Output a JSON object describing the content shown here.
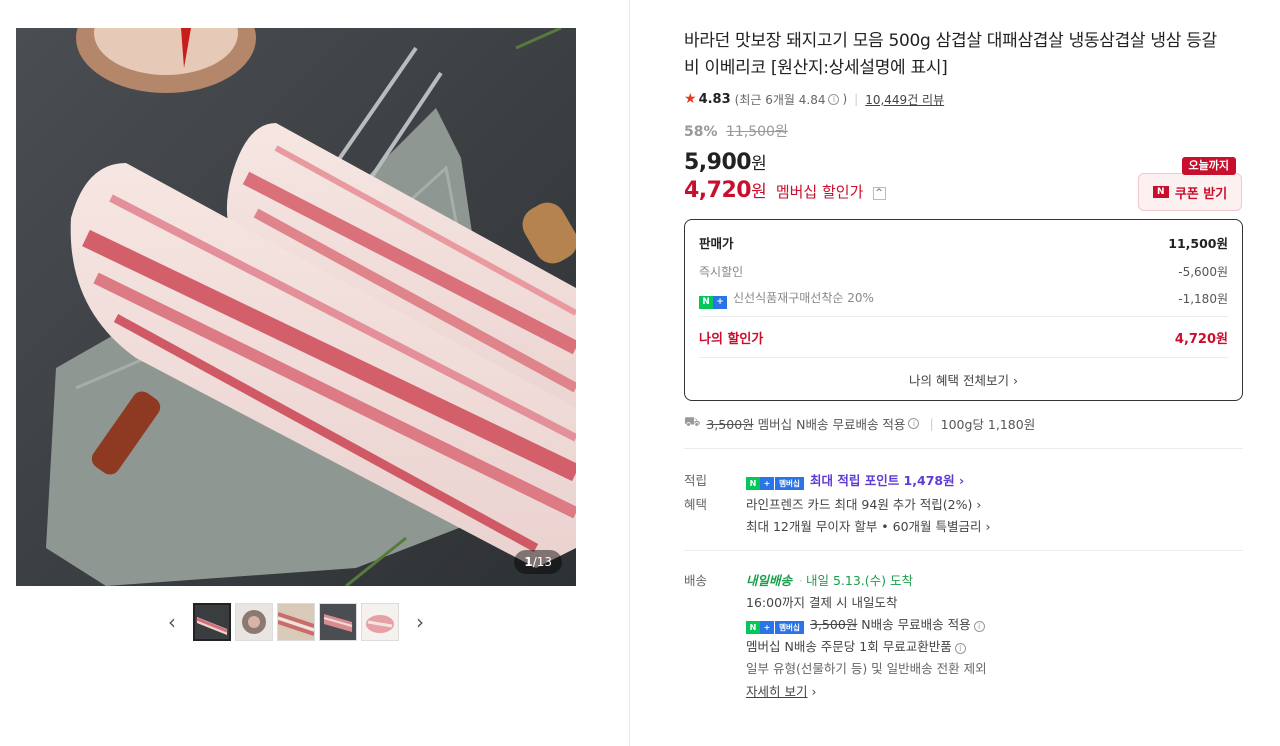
{
  "gallery": {
    "counter_current": "1",
    "counter_total": "/13",
    "prev_arrow": "‹",
    "next_arrow": "›",
    "thumb_count": 5
  },
  "product": {
    "title": "바라던 맛보장 돼지고기 모음 500g 삼겹살 대패삼겹살 냉동삼겹살 냉삼 등갈비 이베리코 [원산지:상세설명에 표시]",
    "rating": "4.83",
    "rating_recent": "(최근 6개월 4.84",
    "rating_recent_close": ")",
    "reviews": "10,449건 리뷰",
    "discount_pct": "58%",
    "original_price": "11,500원",
    "price": "5,900",
    "price_unit": "원",
    "member_price": "4,720",
    "member_price_unit": "원",
    "member_label": "멤버십 할인가",
    "coupon_badge": "오늘까지",
    "coupon_label": "쿠폰 받기",
    "coupon_n": "N"
  },
  "breakdown": {
    "sale_label": "판매가",
    "sale_value": "11,500원",
    "instant_label": "즉시할인",
    "instant_value": "-5,600원",
    "np_n": "N",
    "np_plus": "+",
    "fresh_label": "신선식품재구매선착순 20%",
    "fresh_value": "-1,180원",
    "mine_label": "나의 할인가",
    "mine_value": "4,720원",
    "more": "나의 혜택 전체보기 ›"
  },
  "shipping_summary": {
    "strike": "3,500원",
    "text": "멤버십 N배송 무료배송 적용",
    "per100": "100g당 1,180원"
  },
  "points": {
    "label": "적립",
    "badge_n": "N",
    "badge_plus": "+",
    "badge_member": "멤버십",
    "text": "최대 적립 포인트 1,478원 ›"
  },
  "benefits": {
    "label": "혜택",
    "line1": "라인프렌즈 카드 최대 94원 추가 적립(2%) ›",
    "line2": "최대 12개월 무이자 할부 • 60개월 특별금리 ›"
  },
  "delivery": {
    "label": "배송",
    "nextday": "내일배송",
    "arrival": "내일 5.13.(수) 도착",
    "line1": "16:00까지 결제 시 내일도착",
    "strike": "3,500원",
    "line2": "N배송 무료배송 적용",
    "line3": "멤버십 N배송 주문당 1회 무료교환반품",
    "line4": "일부 유형(선물하기 등) 및 일반배송 전환 제외",
    "more": "자세히 보기"
  },
  "icons": {
    "star": "★",
    "info": "i",
    "truck": "⛟",
    "chevron_up": "^",
    "chevron_right": "›"
  },
  "colors": {
    "accent_red": "#c8102e",
    "naver_green": "#03c75a",
    "plus_blue": "#2a74e8",
    "points_purple": "#5f3bd6"
  }
}
